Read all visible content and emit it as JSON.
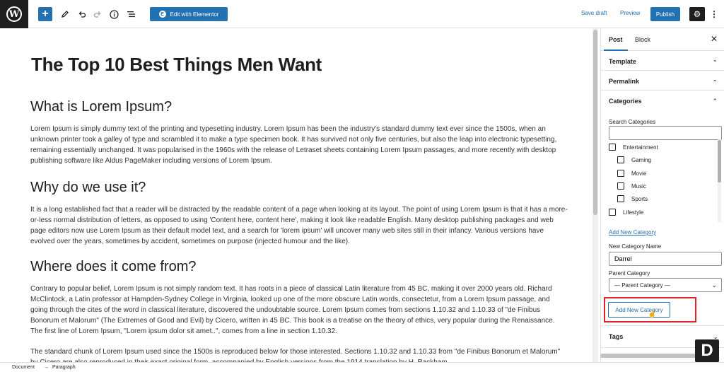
{
  "toolbar": {
    "logo_letter": "W",
    "add_icon": "+",
    "elementor_label": "Edit with Elementor",
    "save_draft": "Save draft",
    "preview": "Preview",
    "publish": "Publish"
  },
  "post": {
    "title": "The Top 10 Best Things Men Want",
    "sections": [
      {
        "heading": "What is Lorem Ipsum?",
        "paragraph": "Lorem Ipsum is simply dummy text of the printing and typesetting industry. Lorem Ipsum has been the industry's standard dummy text ever since the 1500s, when an unknown printer took a galley of type and scrambled it to make a type specimen book. It has survived not only five centuries, but also the leap into electronic typesetting, remaining essentially unchanged. It was popularised in the 1960s with the release of Letraset sheets containing Lorem Ipsum passages, and more recently with desktop publishing software like Aldus PageMaker including versions of Lorem Ipsum."
      },
      {
        "heading": "Why do we use it?",
        "paragraph": "It is a long established fact that a reader will be distracted by the readable content of a page when looking at its layout. The point of using Lorem Ipsum is that it has a more-or-less normal distribution of letters, as opposed to using 'Content here, content here', making it look like readable English. Many desktop publishing packages and web page editors now use Lorem Ipsum as their default model text, and a search for 'lorem ipsum' will uncover many web sites still in their infancy. Various versions have evolved over the years, sometimes by accident, sometimes on purpose (injected humour and the like)."
      },
      {
        "heading": "Where does it come from?",
        "paragraph": "Contrary to popular belief, Lorem Ipsum is not simply random text. It has roots in a piece of classical Latin literature from 45 BC, making it over 2000 years old. Richard McClintock, a Latin professor at Hampden-Sydney College in Virginia, looked up one of the more obscure Latin words, consectetur, from a Lorem Ipsum passage, and going through the cites of the word in classical literature, discovered the undoubtable source. Lorem Ipsum comes from sections 1.10.32 and 1.10.33 of \"de Finibus Bonorum et Malorum\" (The Extremes of Good and Evil) by Cicero, written in 45 BC. This book is a treatise on the theory of ethics, very popular during the Renaissance. The first line of Lorem Ipsum, \"Lorem ipsum dolor sit amet..\", comes from a line in section 1.10.32.",
        "paragraph2": "The standard chunk of Lorem Ipsum used since the 1500s is reproduced below for those interested. Sections 1.10.32 and 1.10.33 from \"de Finibus Bonorum et Malorum\" by Cicero are also reproduced in their exact original form, accompanied by English versions from the 1914 translation by H. Rackham."
      }
    ]
  },
  "sidebar": {
    "tab_post": "Post",
    "tab_block": "Block",
    "close": "✕",
    "panels": {
      "template": "Template",
      "permalink": "Permalink",
      "categories": "Categories",
      "tags": "Tags"
    },
    "search_label": "Search Categories",
    "search_value": "",
    "categories": [
      {
        "label": "Entertainment",
        "indent": false,
        "checked": false
      },
      {
        "label": "Gaming",
        "indent": true,
        "checked": false
      },
      {
        "label": "Movie",
        "indent": true,
        "checked": false
      },
      {
        "label": "Music",
        "indent": true,
        "checked": false
      },
      {
        "label": "Sports",
        "indent": true,
        "checked": false
      },
      {
        "label": "Lifestyle",
        "indent": false,
        "checked": false
      }
    ],
    "add_new_link": "Add New Category",
    "new_name_label": "New Category Name",
    "new_name_value": "Darrel",
    "parent_label": "Parent Category",
    "parent_value": "— Parent Category —",
    "add_button": "Add New Category"
  },
  "footer": {
    "crumb1": "Document",
    "arrow": "→",
    "crumb2": "Paragraph"
  },
  "watermark": "D"
}
